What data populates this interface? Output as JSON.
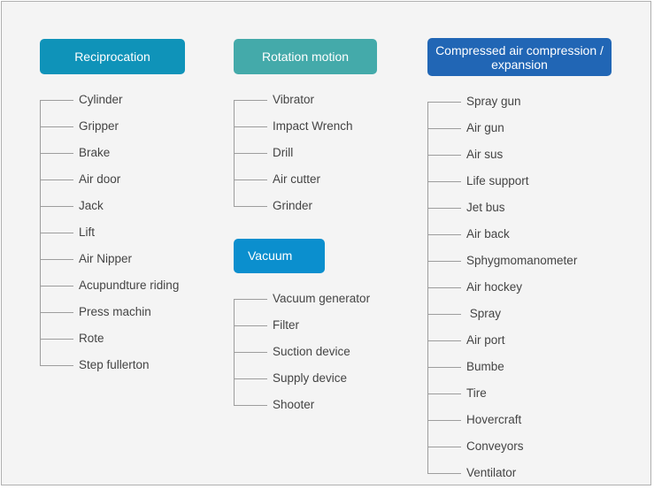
{
  "canvas": {
    "background_color": "#f4f4f4",
    "border_color": "#b0b0b0",
    "line_color": "#9d9d9d",
    "label_color": "#444444"
  },
  "groups": [
    {
      "id": "reciprocation",
      "title": "Reciprocation",
      "color": "#0f93b9",
      "title_align": "center",
      "items": [
        "Cylinder",
        "Gripper",
        "Brake",
        "Air door",
        "Jack",
        "Lift",
        "Air Nipper",
        "Acupundture riding",
        "Press machin",
        "Rote",
        "Step fullerton"
      ]
    },
    {
      "id": "rotation-motion",
      "title": "Rotation motion",
      "color": "#44aaaa",
      "title_align": "center",
      "items": [
        "Vibrator",
        "Impact Wrench",
        "Drill",
        "Air cutter",
        "Grinder"
      ]
    },
    {
      "id": "vacuum",
      "title": "Vacuum",
      "color": "#0b8fce",
      "title_align": "left",
      "items": [
        "Vacuum generator",
        "Filter",
        "Suction device",
        "Supply device",
        "Shooter"
      ]
    },
    {
      "id": "compressed-air",
      "title": "Compressed air compression /\nexpansion",
      "color": "#2166b5",
      "title_align": "center",
      "items": [
        "Spray gun",
        "Air gun",
        "Air sus",
        "Life support",
        "Jet bus",
        "Air back",
        "Sphygmomanometer",
        "Air hockey",
        " Spray",
        "Air port",
        "Bumbe",
        "Tire",
        "Hovercraft",
        "Conveyors",
        "Ventilator"
      ]
    }
  ]
}
